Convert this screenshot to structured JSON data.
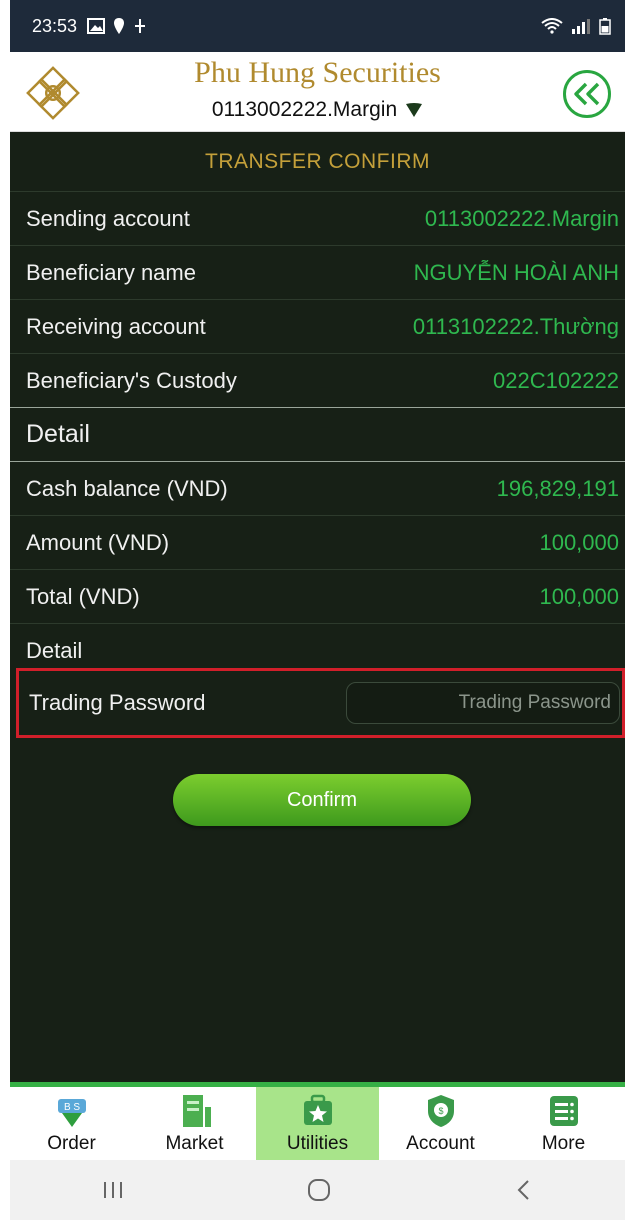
{
  "status_bar": {
    "time": "23:53"
  },
  "header": {
    "brand": "Phu Hung Securities",
    "account": "0113002222.Margin"
  },
  "page": {
    "title": "TRANSFER CONFIRM"
  },
  "info_rows": [
    {
      "label": "Sending account",
      "value": "0113002222.Margin"
    },
    {
      "label": "Beneficiary name",
      "value": "NGUYỄN HOÀI ANH"
    },
    {
      "label": "Receiving account",
      "value": "0113102222.Thường"
    },
    {
      "label": "Beneficiary's Custody",
      "value": "022C102222"
    }
  ],
  "detail_section": {
    "label": "Detail"
  },
  "amount_rows": [
    {
      "label": "Cash balance (VND)",
      "value": "196,829,191"
    },
    {
      "label": "Amount (VND)",
      "value": "100,000"
    },
    {
      "label": "Total (VND)",
      "value": "100,000"
    }
  ],
  "detail_label_2": "Detail",
  "password": {
    "label": "Trading Password",
    "placeholder": "Trading Password",
    "value": ""
  },
  "confirm_label": "Confirm",
  "bottom_nav": [
    {
      "label": "Order",
      "icon": "order-icon"
    },
    {
      "label": "Market",
      "icon": "market-icon"
    },
    {
      "label": "Utilities",
      "icon": "utilities-icon",
      "active": true
    },
    {
      "label": "Account",
      "icon": "account-icon"
    },
    {
      "label": "More",
      "icon": "more-icon"
    }
  ],
  "colors": {
    "accent_green": "#2fb84f",
    "gold": "#b08a2e",
    "highlight_red": "#d11f2a",
    "panel_bg": "#172016"
  }
}
